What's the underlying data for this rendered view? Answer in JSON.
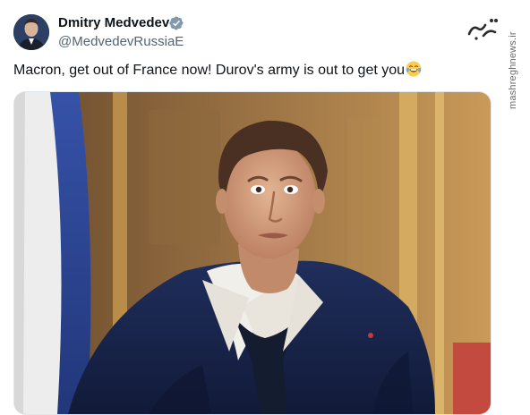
{
  "author": {
    "name": "Dmitry Medvedev",
    "handle": "@MedvedevRussiaE",
    "verified": true,
    "verified_color": "#829aab"
  },
  "tweet": {
    "text": "Macron, get out of France now! Durov's army is out to get you",
    "emoji": "face-with-tears-of-joy"
  },
  "watermark": {
    "text": "mashreghnews.ir"
  },
  "media": {
    "icon": "photo-media"
  }
}
